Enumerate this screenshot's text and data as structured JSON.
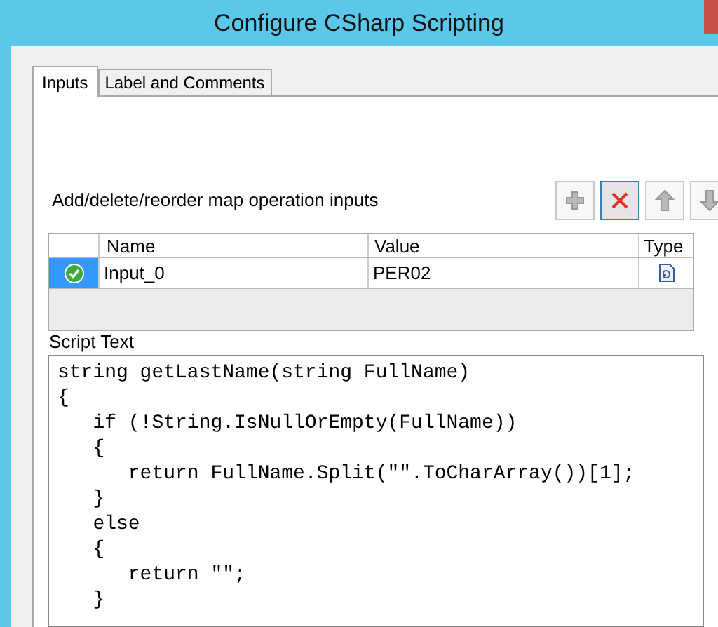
{
  "window": {
    "title": "Configure CSharp Scripting"
  },
  "tabs": [
    {
      "label": "Inputs",
      "selected": true
    },
    {
      "label": "Label and Comments",
      "selected": false
    }
  ],
  "inputs_label": "Add/delete/reorder map operation inputs",
  "toolbar": [
    {
      "kind": "add",
      "selected": false
    },
    {
      "kind": "delete",
      "selected": true
    },
    {
      "kind": "up",
      "selected": false
    },
    {
      "kind": "down",
      "selected": false
    }
  ],
  "table": {
    "columns": [
      "Name",
      "Value",
      "Type"
    ],
    "rows": [
      {
        "name": "Input_0",
        "value": "PER02",
        "selected": true
      }
    ]
  },
  "script_label": "Script Text",
  "script_lines": [
    "string getLastName(string FullName)",
    "{",
    "   if (!String.IsNullOrEmpty(FullName))",
    "   {",
    "      return FullName.Split(\"\".ToCharArray())[1];",
    "   }",
    "   else",
    "   {",
    "      return \"\";",
    "   }"
  ]
}
